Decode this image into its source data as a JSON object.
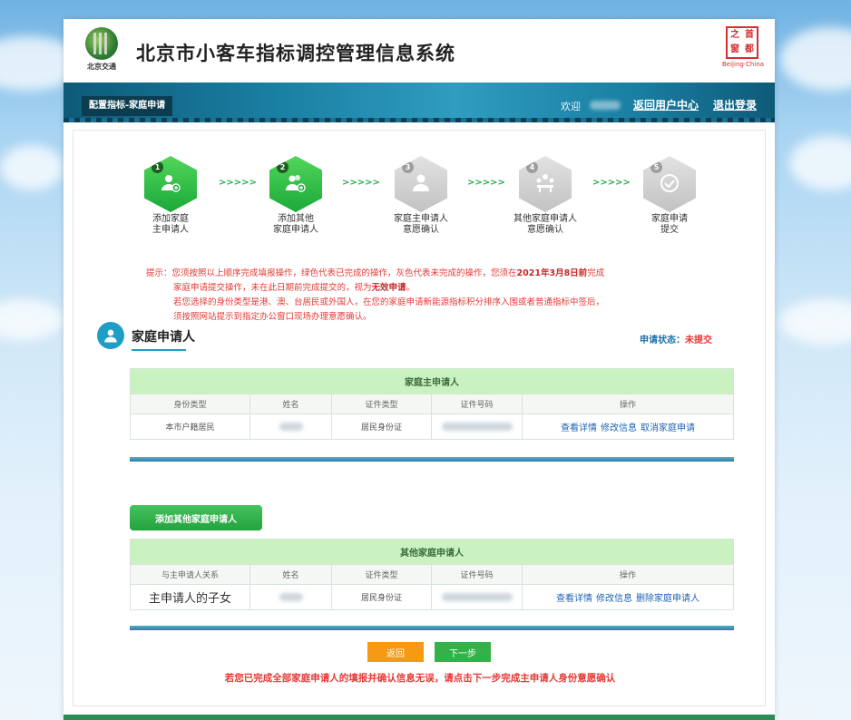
{
  "header": {
    "logo_left_caption": "北京交通",
    "system_title": "北京市小客车指标调控管理信息系统",
    "logo_right_seal": [
      "之",
      "首",
      "窗",
      "都"
    ],
    "logo_right_caption": "Beijing·China"
  },
  "nav": {
    "breadcrumb": "配置指标-家庭申请",
    "welcome": "欢迎",
    "user_center": "返回用户中心",
    "logout": "退出登录"
  },
  "steps": [
    {
      "number": "1",
      "line1": "添加家庭",
      "line2": "主申请人",
      "state": "done",
      "icon": "user-plus-icon"
    },
    {
      "number": "2",
      "line1": "添加其他",
      "line2": "家庭申请人",
      "state": "done",
      "icon": "users-plus-icon"
    },
    {
      "number": "3",
      "line1": "家庭主申请人",
      "line2": "意愿确认",
      "state": "todo",
      "icon": "user-icon"
    },
    {
      "number": "4",
      "line1": "其他家庭申请人",
      "line2": "意愿确认",
      "state": "todo",
      "icon": "group-icon"
    },
    {
      "number": "5",
      "line1": "家庭申请",
      "line2": "提交",
      "state": "todo",
      "icon": "check-icon"
    }
  ],
  "step_arrow": ">>>>>",
  "notice": {
    "l1_a": "提示：您须按照以上顺序完成填报操作，绿色代表已完成的操作，灰色代表未完成的操作，您须在",
    "l1_deadline": "2021年3月8日前",
    "l1_b": "完成",
    "l2_a": "家庭申请提交操作，未在此日期前完成提交的，视为",
    "l2_invalid": "无效申请",
    "l2_b": "。",
    "l3": "若您选择的身份类型是港、澳、台居民或外国人，在您的家庭申请新能源指标积分排序入围或者普通指标中签后，",
    "l4": "须按照网站提示到指定办公窗口现场办理意愿确认。"
  },
  "section": {
    "title": "家庭申请人",
    "status_label": "申请状态：",
    "status_value": "未提交"
  },
  "main_table": {
    "caption": "家庭主申请人",
    "headers": [
      "身份类型",
      "姓名",
      "证件类型",
      "证件号码",
      "操作"
    ],
    "row": {
      "identity": "本市户籍居民",
      "id_type": "居民身份证"
    },
    "actions": [
      "查看详情",
      "修改信息",
      "取消家庭申请"
    ]
  },
  "add_button": "添加其他家庭申请人",
  "other_table": {
    "caption": "其他家庭申请人",
    "headers": [
      "与主申请人关系",
      "姓名",
      "证件类型",
      "证件号码",
      "操作"
    ],
    "row": {
      "relation": "主申请人的子女",
      "id_type": "居民身份证"
    },
    "actions": [
      "查看详情",
      "修改信息",
      "删除家庭申请人"
    ]
  },
  "buttons": {
    "back": "返回",
    "next": "下一步"
  },
  "final_note": "若您已完成全部家庭申请人的填报并确认信息无误，请点击下一步完成主申请人身份意愿确认"
}
